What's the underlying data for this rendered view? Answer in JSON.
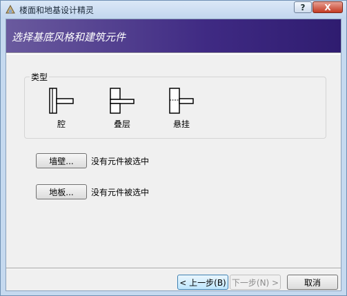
{
  "window": {
    "title": "楼面和地基设计精灵",
    "help_glyph": "?",
    "close_glyph": "X"
  },
  "banner": {
    "title": "选择基底风格和建筑元件"
  },
  "type_group": {
    "label": "类型",
    "options": [
      {
        "label": "腔",
        "icon": "cavity-icon"
      },
      {
        "label": "叠层",
        "icon": "stacked-icon"
      },
      {
        "label": "悬挂",
        "icon": "suspended-icon"
      }
    ]
  },
  "components": [
    {
      "button_label": "墙壁...",
      "status": "没有元件被选中"
    },
    {
      "button_label": "地板...",
      "status": "没有元件被选中"
    }
  ],
  "footer": {
    "back_label": "< 上一步(B)",
    "next_label": "下一步(N) >",
    "cancel_label": "取消"
  }
}
